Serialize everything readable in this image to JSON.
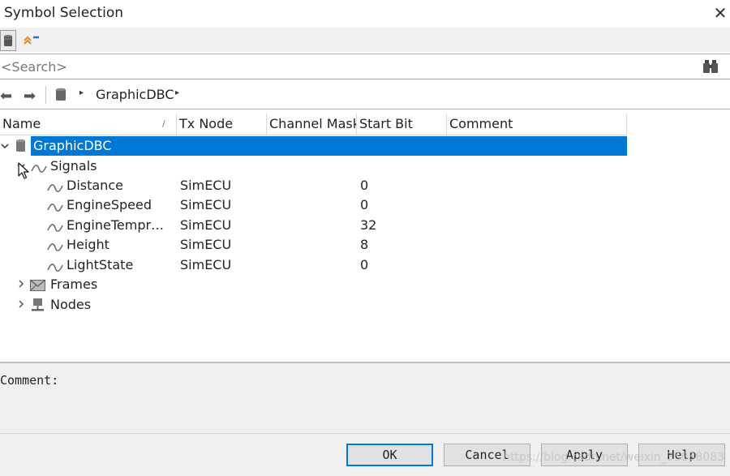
{
  "window": {
    "title": "Symbol Selection",
    "close_glyph": "✕"
  },
  "toolbar": {
    "icons": [
      "database-icon",
      "expand-up-icon"
    ]
  },
  "search": {
    "placeholder": "<Search>",
    "icon": "binoculars-icon"
  },
  "nav": {
    "back_glyph": "⬅",
    "forward_glyph": "➡",
    "breadcrumb": [
      "GraphicDBC"
    ],
    "arrow_glyph": "▸"
  },
  "table": {
    "columns": [
      "Name",
      "Tx Node",
      "Channel Mask",
      "Start Bit",
      "Comment"
    ],
    "sort_glyph": "/",
    "root": {
      "label": "GraphicDBC",
      "expanded": true,
      "selected": true
    },
    "groups": [
      {
        "label": "Signals",
        "icon": "signal-wave-icon",
        "expanded": true
      },
      {
        "label": "Frames",
        "icon": "envelope-icon",
        "expanded": false
      },
      {
        "label": "Nodes",
        "icon": "network-node-icon",
        "expanded": false
      }
    ],
    "signals": [
      {
        "name": "Distance",
        "tx_node": "SimECU",
        "channel_mask": "",
        "start_bit": "0",
        "comment": ""
      },
      {
        "name": "EngineSpeed",
        "tx_node": "SimECU",
        "channel_mask": "",
        "start_bit": "0",
        "comment": ""
      },
      {
        "name": "EngineTempr…",
        "tx_node": "SimECU",
        "channel_mask": "",
        "start_bit": "32",
        "comment": ""
      },
      {
        "name": "Height",
        "tx_node": "SimECU",
        "channel_mask": "",
        "start_bit": "8",
        "comment": ""
      },
      {
        "name": "LightState",
        "tx_node": "SimECU",
        "channel_mask": "",
        "start_bit": "0",
        "comment": ""
      }
    ]
  },
  "comment_panel": {
    "label": "Comment:"
  },
  "buttons": {
    "ok": "OK",
    "cancel": "Cancel",
    "apply": "Apply",
    "help": "Help"
  },
  "watermark": "https://blog.csdn.net/weixin_35888083",
  "colors": {
    "selection": "#0078d7",
    "panel": "#f0f0f0",
    "button": "#e1e1e1"
  }
}
